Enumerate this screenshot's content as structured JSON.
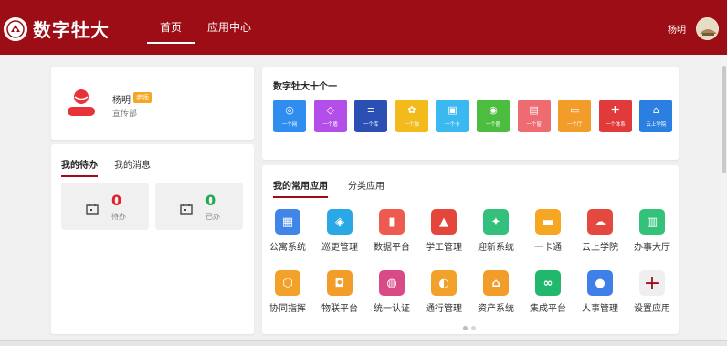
{
  "header": {
    "logo_text": "数字牡大",
    "nav": [
      {
        "label": "首页",
        "active": true
      },
      {
        "label": "应用中心",
        "active": false
      }
    ],
    "user_name": "杨明"
  },
  "profile": {
    "name": "杨明",
    "badge": "老师",
    "department": "宣传部"
  },
  "todo_panel": {
    "tabs": [
      "我的待办",
      "我的消息"
    ],
    "stats": [
      {
        "count": "0",
        "label": "待办",
        "color": "#e0202d"
      },
      {
        "count": "0",
        "label": "已办",
        "color": "#20a950"
      }
    ]
  },
  "top10": {
    "title": "数字牡大十个一",
    "tiles": [
      {
        "label": "一个网",
        "glyph": "◎",
        "color": "#2f8df0"
      },
      {
        "label": "一个盾",
        "glyph": "◇",
        "color": "#b44ee8"
      },
      {
        "label": "一个库",
        "glyph": "≡",
        "color": "#2b4fb3"
      },
      {
        "label": "一个脑",
        "glyph": "✿",
        "color": "#f2ba1b"
      },
      {
        "label": "一个卡",
        "glyph": "▣",
        "color": "#3cb8f0"
      },
      {
        "label": "一个圈",
        "glyph": "◉",
        "color": "#4cbd3e"
      },
      {
        "label": "一个窗",
        "glyph": "▤",
        "color": "#ee6b72"
      },
      {
        "label": "一个厅",
        "glyph": "▭",
        "color": "#f29c2a"
      },
      {
        "label": "一个体系",
        "glyph": "✚",
        "color": "#e03a3a"
      },
      {
        "label": "云上学院",
        "glyph": "⌂",
        "color": "#2b7fe0"
      }
    ]
  },
  "apps": {
    "tabs": [
      "我的常用应用",
      "分类应用"
    ],
    "items": [
      {
        "label": "公寓系统",
        "icon": "apartment-icon",
        "glyph": "▦",
        "color": "#3f86e8"
      },
      {
        "label": "巡更管理",
        "icon": "patrol-icon",
        "glyph": "◈",
        "color": "#2aa8e6"
      },
      {
        "label": "数据平台",
        "icon": "chart-icon",
        "glyph": "▮",
        "color": "#ee5a4f"
      },
      {
        "label": "学工管理",
        "icon": "graduation-icon",
        "glyph": "▲",
        "color": "#e4463c"
      },
      {
        "label": "迎新系统",
        "icon": "welcome-icon",
        "glyph": "✦",
        "color": "#32c07c"
      },
      {
        "label": "一卡通",
        "icon": "card-icon",
        "glyph": "▬",
        "color": "#f5a623"
      },
      {
        "label": "云上学院",
        "icon": "cloud-icon",
        "glyph": "☁",
        "color": "#e5483e"
      },
      {
        "label": "办事大厅",
        "icon": "hall-icon",
        "glyph": "▥",
        "color": "#34c27a"
      },
      {
        "label": "协同指挥",
        "icon": "collab-icon",
        "glyph": "⬡",
        "color": "#f2a22a"
      },
      {
        "label": "物联平台",
        "icon": "iot-icon",
        "glyph": "◘",
        "color": "#f29c2a"
      },
      {
        "label": "统一认证",
        "icon": "fingerprint-icon",
        "glyph": "◍",
        "color": "#d94b86"
      },
      {
        "label": "通行管理",
        "icon": "access-icon",
        "glyph": "◐",
        "color": "#f2a22a"
      },
      {
        "label": "资产系统",
        "icon": "asset-icon",
        "glyph": "⌂",
        "color": "#f29c2a"
      },
      {
        "label": "集成平台",
        "icon": "integration-icon",
        "glyph": "∞",
        "color": "#21b86d"
      },
      {
        "label": "人事管理",
        "icon": "hr-icon",
        "glyph": "●",
        "color": "#3f7fe8"
      },
      {
        "label": "设置应用",
        "icon": "plus-icon",
        "glyph": "+",
        "color": "#efefef"
      }
    ],
    "asset_icon_caption": "资产系统"
  }
}
